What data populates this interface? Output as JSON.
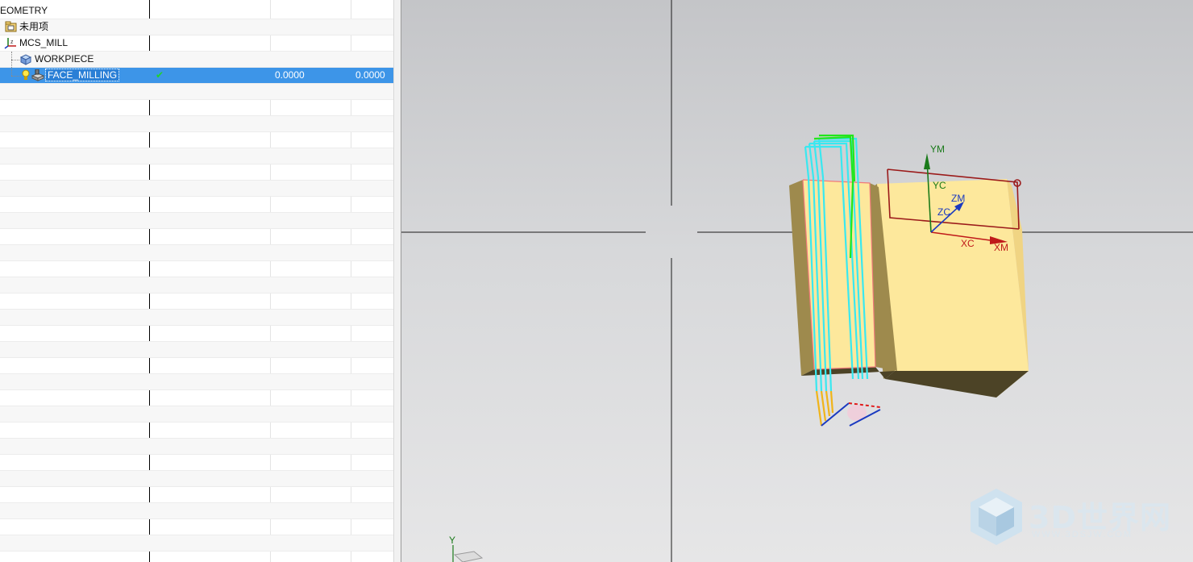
{
  "navigator": {
    "rows": [
      {
        "name": "GEOMETRY",
        "shown_text": "EOMETRY",
        "icon": "geometry-root-icon"
      },
      {
        "name": "未用项",
        "icon": "unused-items-folder-icon"
      },
      {
        "name": "MCS_MILL",
        "icon": "mcs-coordinate-icon"
      },
      {
        "name": "WORKPIECE",
        "icon": "workpiece-cube-icon"
      },
      {
        "name": "FACE_MILLING",
        "icon": "face-milling-operation-icon",
        "selected": true,
        "status": "✔",
        "value1": "0.0000",
        "value2": "0.0000"
      }
    ]
  },
  "viewport": {
    "labels": {
      "ym": "YM",
      "yc": "YC",
      "zm": "ZM",
      "zc": "ZC",
      "xc": "XC",
      "xm": "XM",
      "triad_y": "Y"
    },
    "colors": {
      "part_face": "#fde89c",
      "part_shadow": "#9e8a4d",
      "part_dark": "#4c4326",
      "toolpath": "#39e8f0",
      "toolpath_engage": "#22e61a",
      "toolpath_rapid": "#f0b41a",
      "boundary": "#9b1a1a"
    }
  },
  "watermark": {
    "text": "3D世界网",
    "url": "WWW.3DSJW.COM"
  }
}
